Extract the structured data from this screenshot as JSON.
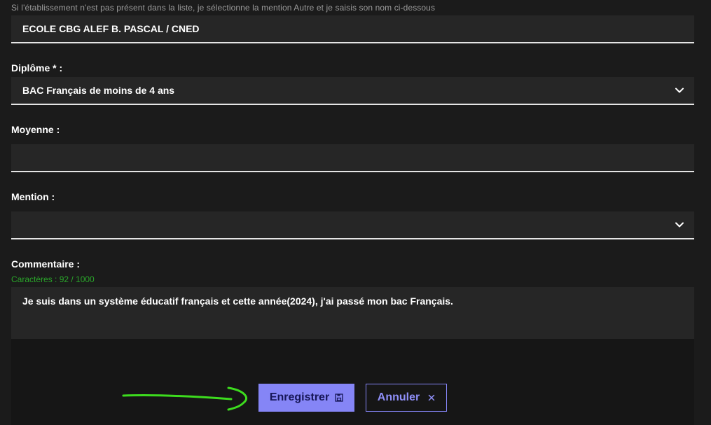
{
  "form": {
    "establishment_hint": "Si l'établissement n'est pas présent dans la liste, je sélectionne la mention Autre et je saisis son nom ci-dessous",
    "establishment_value": "ECOLE CBG ALEF B. PASCAL / CNED",
    "diploma_label": "Diplôme * :",
    "diploma_value": "BAC Français de moins de 4 ans",
    "average_label": "Moyenne :",
    "average_value": "",
    "mention_label": "Mention :",
    "mention_value": "",
    "comment_label": "Commentaire :",
    "comment_counter": "Caractères : 92 / 1000",
    "comment_value": "Je suis dans un système éducatif français et cette année(2024), j'ai passé mon bac Français."
  },
  "actions": {
    "save_label": "Enregistrer",
    "cancel_label": "Annuler"
  },
  "icons": {
    "select_chevron": "chevron-down-icon",
    "save": "floppy-disk-icon",
    "cancel": "close-icon",
    "annotation": "green-arrow-annotation"
  },
  "colors": {
    "background": "#1b1b1b",
    "field_bg": "#262626",
    "accent": "#8585f6",
    "counter": "#2aa52a",
    "annotation": "#3ddc1e"
  }
}
